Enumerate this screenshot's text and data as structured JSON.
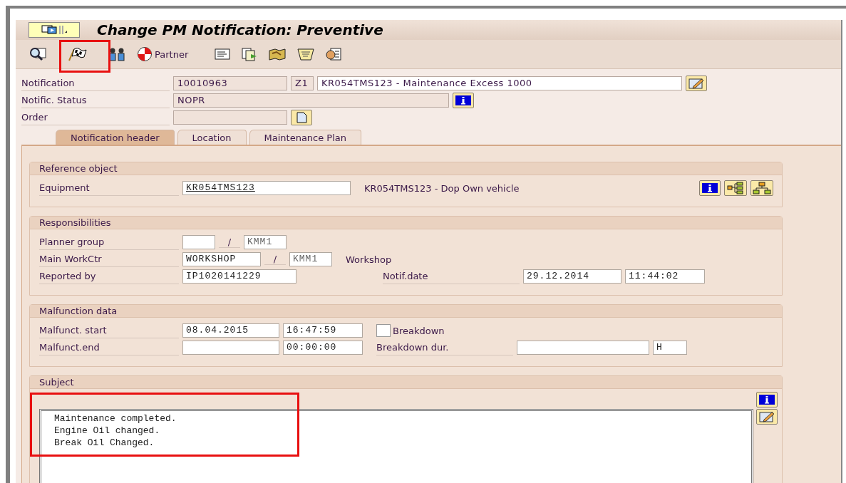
{
  "window": {
    "title": "Change PM Notification: Preventive"
  },
  "toolbar": {
    "partner_label": "Partner"
  },
  "header": {
    "notification": {
      "label": "Notification",
      "number": {
        "value": "10010963",
        "readonly": true
      },
      "type": {
        "value": "Z1",
        "readonly": true
      },
      "description": {
        "value": "KR054TMS123 - Maintenance Excess 1000",
        "readonly": false
      }
    },
    "status": {
      "label": "Notific. Status",
      "value": {
        "value": "NOPR",
        "readonly": true
      }
    },
    "order": {
      "label": "Order",
      "value": {
        "readonly": true
      }
    }
  },
  "tabs": [
    {
      "label": "Notification header",
      "selected": true
    },
    {
      "label": "Location",
      "selected": false
    },
    {
      "label": "Maintenance Plan",
      "selected": false
    }
  ],
  "reference_object": {
    "title": "Reference object",
    "label": "Equipment",
    "value": "KR054TMS123",
    "description": "KR054TMS123 - Dop Own vehicle"
  },
  "responsibilities": {
    "title": "Responsibilities",
    "planner_group": {
      "label": "Planner group",
      "separator": "/",
      "plant": "KMM1"
    },
    "main_workctr": {
      "label": "Main WorkCtr",
      "value": "WORKSHOP",
      "separator": "/",
      "plant": "KMM1",
      "description": "Workshop"
    },
    "reported_by": {
      "label": "Reported by",
      "value": "IP1020141229"
    },
    "notif_date": {
      "label": "Notif.date",
      "date": "29.12.2014",
      "time": "11:44:02"
    }
  },
  "malfunction": {
    "title": "Malfunction data",
    "start": {
      "label": "Malfunct. start",
      "date": "08.04.2015",
      "time": "16:47:59"
    },
    "end": {
      "label": "Malfunct.end",
      "time": "00:00:00"
    },
    "breakdown": {
      "label": "Breakdown",
      "checked": false
    },
    "duration": {
      "label": "Breakdown dur.",
      "unit": "H"
    }
  },
  "subject": {
    "title": "Subject",
    "lines": [
      "Maintenance completed.",
      "Engine Oil changed.",
      "Break Oil Changed."
    ]
  }
}
